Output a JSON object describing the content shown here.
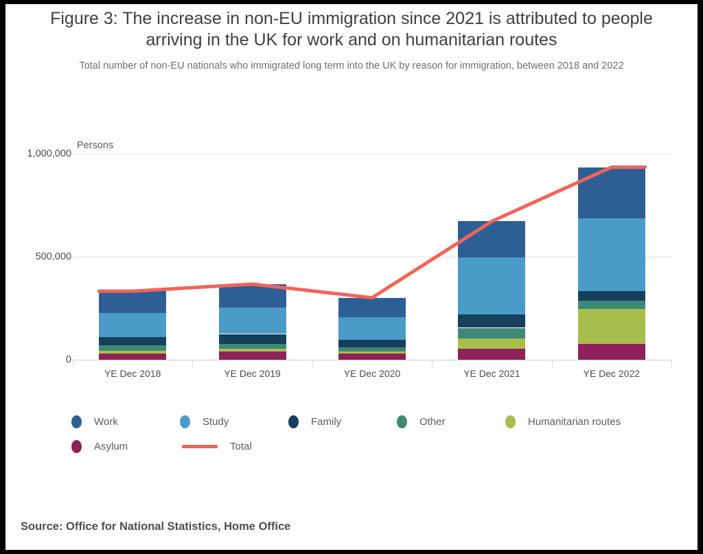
{
  "figure": {
    "title": "Figure 3: The increase in non-EU immigration since 2021 is attributed to people arriving in the UK for work and on humanitarian routes",
    "subtitle": "Total number of non-EU nationals who immigrated long term into the UK by reason for immigration, between 2018 and 2022",
    "source": "Source: Office for National Statistics, Home Office",
    "axis_unit_label": "Persons"
  },
  "legend": {
    "row1": [
      {
        "label": "Work",
        "color": "#2E5F94",
        "marker": "dot"
      },
      {
        "label": "Study",
        "color": "#4A9BC8",
        "marker": "dot"
      },
      {
        "label": "Family",
        "color": "#17405E",
        "marker": "dot"
      },
      {
        "label": "Other",
        "color": "#3D8876",
        "marker": "dot"
      },
      {
        "label": "Humanitarian routes",
        "color": "#A7BE4D",
        "marker": "dot"
      }
    ],
    "row2": [
      {
        "label": "Asylum",
        "color": "#8E2157",
        "marker": "dot"
      },
      {
        "label": "Total",
        "color": "#F2645A",
        "marker": "line"
      }
    ]
  },
  "chart_data": {
    "type": "bar",
    "stacked": true,
    "title": "Figure 3: The increase in non-EU immigration since 2021 is attributed to people arriving in the UK for work and on humanitarian routes",
    "subtitle": "Total number of non-EU nationals who immigrated long term into the UK by reason for immigration, between 2018 and 2022",
    "xlabel": "",
    "ylabel": "Persons",
    "ylim": [
      0,
      1050000
    ],
    "yticks": [
      0,
      500000,
      1000000
    ],
    "ytick_labels": [
      "0",
      "500,000",
      "1,000,000"
    ],
    "grid": true,
    "legend_position": "bottom",
    "categories": [
      "YE Dec 2018",
      "YE Dec 2019",
      "YE Dec 2020",
      "YE Dec 2021",
      "YE Dec 2022"
    ],
    "series": [
      {
        "name": "Work",
        "color": "#2E5F94",
        "values": [
          107000,
          115000,
          93000,
          175000,
          248000
        ]
      },
      {
        "name": "Study",
        "color": "#4A9BC8",
        "values": [
          117000,
          127000,
          111000,
          278000,
          353000
        ]
      },
      {
        "name": "Family",
        "color": "#17405E",
        "values": [
          40000,
          48000,
          36000,
          64000,
          47000
        ]
      },
      {
        "name": "Other",
        "color": "#3D8876",
        "values": [
          27000,
          23000,
          21000,
          50000,
          40000
        ]
      },
      {
        "name": "Humanitarian routes",
        "color": "#A7BE4D",
        "values": [
          12000,
          13000,
          10000,
          53000,
          170000
        ]
      },
      {
        "name": "Asylum",
        "color": "#8E2157",
        "values": [
          30000,
          41000,
          30000,
          52000,
          77000
        ]
      }
    ],
    "overlay_line": {
      "name": "Total",
      "color": "#F2645A",
      "values": [
        333000,
        367000,
        301000,
        672000,
        935000
      ]
    }
  }
}
